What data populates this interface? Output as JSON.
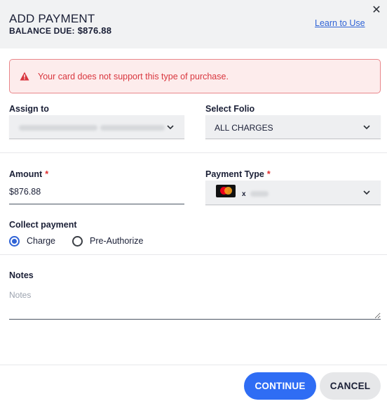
{
  "header": {
    "title": "ADD PAYMENT",
    "balance_label": "BALANCE DUE:",
    "balance_amount": "$876.88",
    "learn_link": "Learn to Use",
    "close_glyph": "✕"
  },
  "alert": {
    "icon": "warning-triangle-icon",
    "message": "Your card does not support this type of purchase.",
    "color": "#d9363e"
  },
  "assign_to": {
    "label": "Assign to"
  },
  "select_folio": {
    "label": "Select Folio",
    "value": "ALL CHARGES"
  },
  "amount": {
    "label": "Amount",
    "required_mark": "*",
    "value": "$876.88"
  },
  "payment_type": {
    "label": "Payment Type",
    "required_mark": "*",
    "card_icon": "mastercard-icon",
    "x_mark": "x"
  },
  "collect_payment": {
    "label": "Collect payment",
    "options": [
      {
        "label": "Charge",
        "selected": true
      },
      {
        "label": "Pre-Authorize",
        "selected": false
      }
    ]
  },
  "notes": {
    "label": "Notes",
    "placeholder": "Notes"
  },
  "footer": {
    "continue_label": "CONTINUE",
    "cancel_label": "CANCEL"
  },
  "colors": {
    "accent": "#2f6df4",
    "header_bg": "#f1f2f3",
    "alert_bg": "#fdecec",
    "alert_border": "#e9868a"
  }
}
